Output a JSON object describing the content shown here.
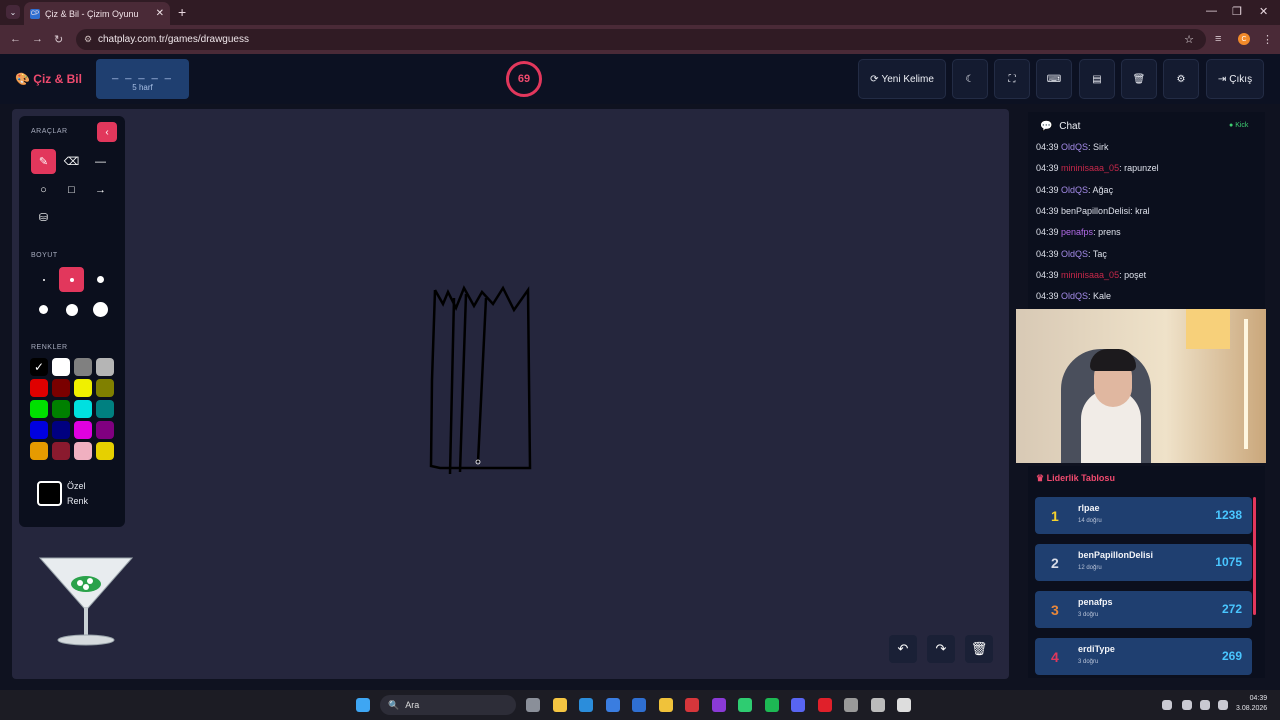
{
  "browser": {
    "tab_title": "Çiz & Bil - Çizim Oyunu",
    "tab_favicon": "CP",
    "new_tab": "+",
    "url": "chatplay.com.tr/games/drawguess",
    "profile_initial": "C"
  },
  "header": {
    "logo": "Çiz & Bil",
    "word_dashes": "_ _ _ _ _",
    "word_length": "5 harf",
    "timer": "69",
    "new_word": "Yeni Kelime",
    "exit": "Çıkış"
  },
  "tools": {
    "section_tools": "ARAÇLAR",
    "section_size": "BOYUT",
    "section_colors": "RENKLER",
    "custom_color": "Özel Renk",
    "colors": [
      "#000000",
      "#ffffff",
      "#808080",
      "#b5b5b5",
      "#e00000",
      "#7a0000",
      "#f0f000",
      "#808000",
      "#00e000",
      "#008000",
      "#00e0e0",
      "#008080",
      "#0000e0",
      "#000080",
      "#e000e0",
      "#800080",
      "#e69b00",
      "#8a1a2e",
      "#f0b0c0",
      "#e6d000"
    ]
  },
  "chat": {
    "title": "Chat",
    "status": "Kick",
    "messages": [
      {
        "time": "04:39",
        "user": "OldQS",
        "text": ": Sirk",
        "color": "#a48be8"
      },
      {
        "time": "04:39",
        "user": "mininisaaa_05",
        "text": ": rapunzel",
        "color": "#c7284a"
      },
      {
        "time": "04:39",
        "user": "OldQS",
        "text": ": Ağaç",
        "color": "#a48be8"
      },
      {
        "time": "04:39",
        "user": "benPapillonDelisi",
        "text": ": kral",
        "color": "#dde0ea"
      },
      {
        "time": "04:39",
        "user": "penafps",
        "text": ": prens",
        "color": "#b36be8"
      },
      {
        "time": "04:39",
        "user": "OldQS",
        "text": ": Taç",
        "color": "#a48be8"
      },
      {
        "time": "04:39",
        "user": "mininisaaa_05",
        "text": ": poşet",
        "color": "#c7284a"
      },
      {
        "time": "04:39",
        "user": "OldQS",
        "text": ": Kale",
        "color": "#a48be8"
      }
    ]
  },
  "leaderboard": {
    "title": "Liderlik Tablosu",
    "rows": [
      {
        "rank": "1",
        "name": "rlpae",
        "sub": "14 doğru",
        "score": "1238",
        "rank_color": "#f6d32d"
      },
      {
        "rank": "2",
        "name": "benPapillonDelisi",
        "sub": "12 doğru",
        "score": "1075",
        "rank_color": "#d8dde8"
      },
      {
        "rank": "3",
        "name": "penafps",
        "sub": "3 doğru",
        "score": "272",
        "rank_color": "#e8873a"
      },
      {
        "rank": "4",
        "name": "erdiType",
        "sub": "3 doğru",
        "score": "269",
        "rank_color": "#e2375c"
      }
    ]
  },
  "taskbar": {
    "search": "Ara",
    "time": "04:39",
    "date": "3.08.2026"
  }
}
